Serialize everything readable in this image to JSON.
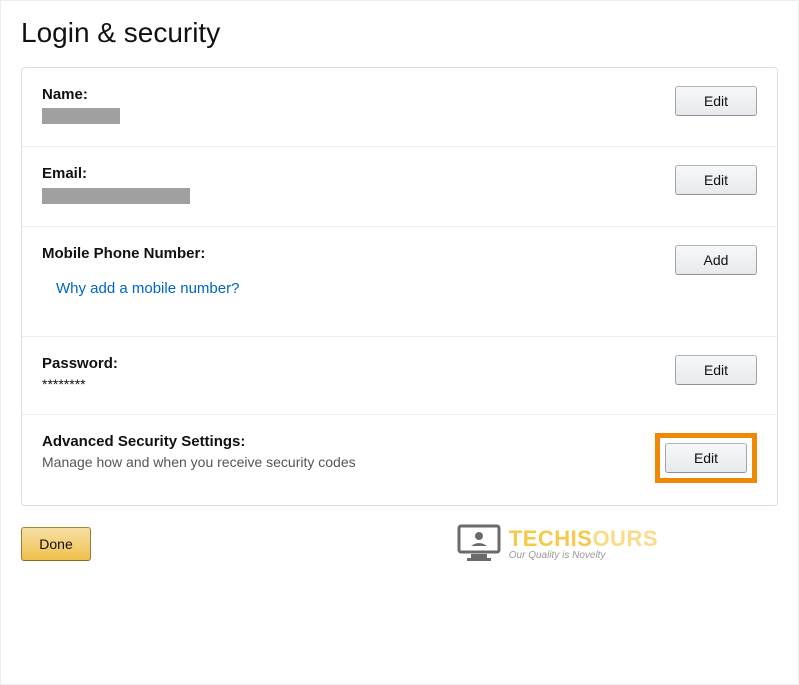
{
  "page": {
    "title": "Login & security"
  },
  "sections": {
    "name": {
      "label": "Name:",
      "button": "Edit"
    },
    "email": {
      "label": "Email:",
      "button": "Edit"
    },
    "mobile": {
      "label": "Mobile Phone Number:",
      "help_link": "Why add a mobile number?",
      "button": "Add"
    },
    "password": {
      "label": "Password:",
      "value": "********",
      "button": "Edit"
    },
    "advanced": {
      "label": "Advanced Security Settings:",
      "help": "Manage how and when you receive security codes",
      "button": "Edit"
    }
  },
  "footer": {
    "done": "Done",
    "brand_name_1": "TECHIS",
    "brand_name_2": "OURS",
    "brand_tag": "Our Quality is Novelty"
  }
}
